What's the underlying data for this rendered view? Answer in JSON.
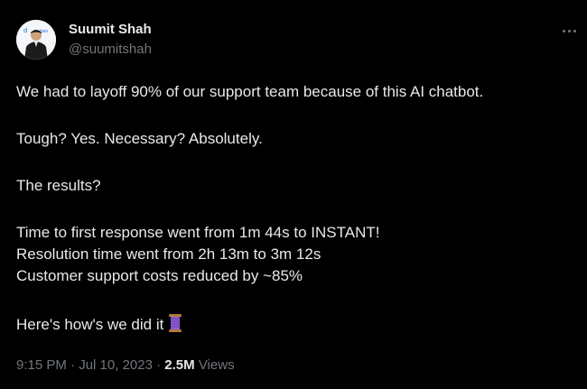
{
  "author": {
    "name": "Suumit Shah",
    "handle": "@suumitshah",
    "avatar_icon": "profile-photo"
  },
  "tweet": {
    "lines": [
      "We had to layoff 90% of our support team because of this AI chatbot.",
      "Tough? Yes. Necessary? Absolutely.",
      "The results?",
      "Time to first response went from 1m 44s to INSTANT!",
      "Resolution time went from 2h 13m to 3m 12s",
      "Customer support costs reduced by ~85%",
      "Here's how's we did it"
    ],
    "thread_emoji": "spool-of-thread-icon"
  },
  "meta": {
    "time": "9:15 PM",
    "date": "Jul 10, 2023",
    "views_count": "2.5M",
    "views_label": "Views"
  },
  "colors": {
    "background": "#000000",
    "text": "#e7e9ea",
    "muted": "#71767b"
  }
}
